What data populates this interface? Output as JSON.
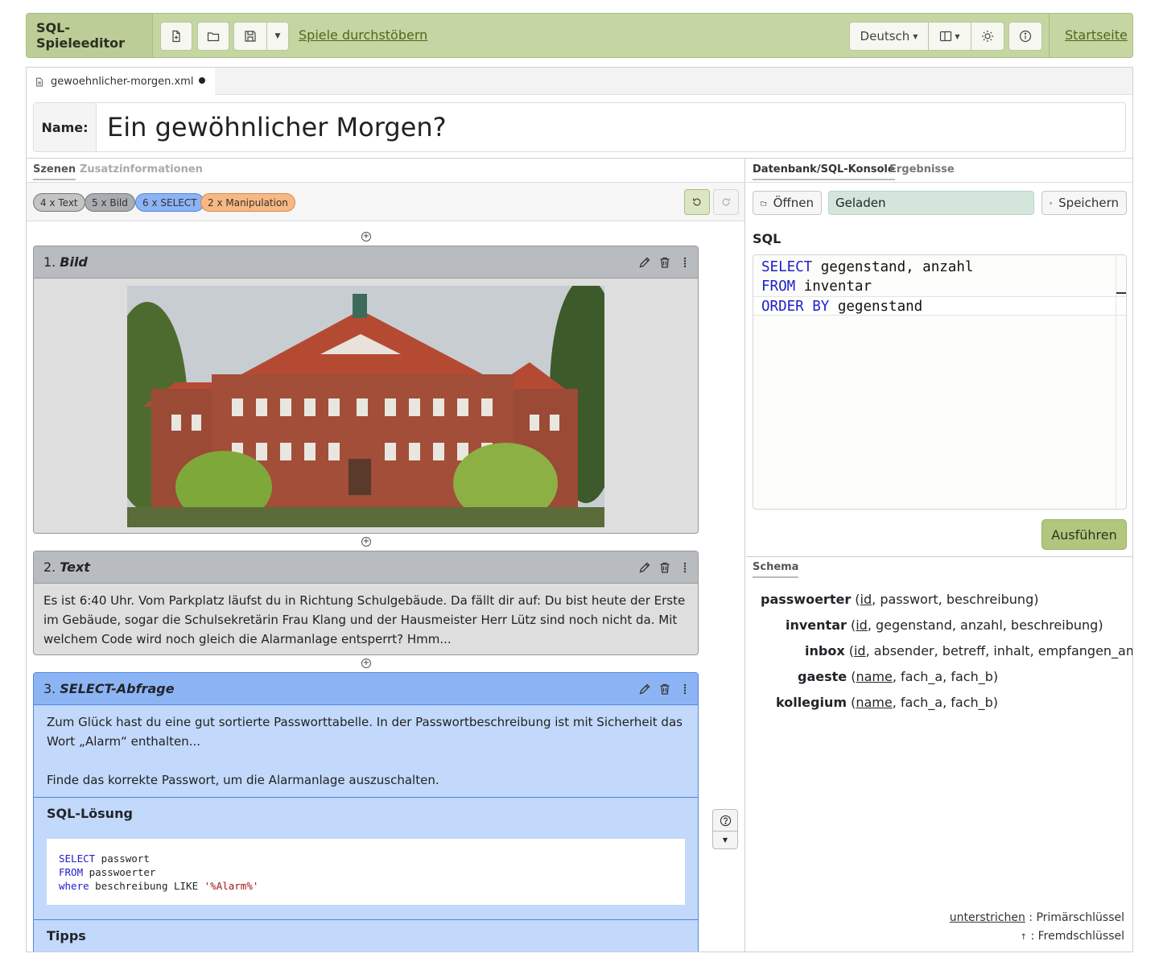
{
  "app": {
    "brand": "SQL-Spieleeditor",
    "browse_link": "Spiele durchstöbern",
    "language": "Deutsch",
    "home_link": "Startseite"
  },
  "file_tab": {
    "filename": "gewoehnlicher-morgen.xml"
  },
  "name_field": {
    "label": "Name:",
    "value": "Ein gewöhnlicher Morgen?"
  },
  "left_tabs": [
    "Szenen",
    "Zusatzinformationen"
  ],
  "badges": [
    {
      "label": "4 x Text",
      "color": "#c4c4c4"
    },
    {
      "label": "5 x Bild",
      "color": "#a9acb0"
    },
    {
      "label": "6 x SELECT",
      "color": "#8cb4f5"
    },
    {
      "label": "2 x Manipulation",
      "color": "#f7b884"
    }
  ],
  "scenes": [
    {
      "number": "1.",
      "title": "Bild"
    },
    {
      "number": "2.",
      "title": "Text",
      "text": "Es ist 6:40 Uhr. Vom Parkplatz läufst du in Richtung Schulgebäude. Da fällt dir auf: Du bist heute der Erste im Gebäude, sogar die Schulsekretärin Frau Klang und der Hausmeister Herr Lütz sind noch nicht da. Mit welchem Code wird noch gleich die Alarmanlage entsperrt? Hmm..."
    },
    {
      "number": "3.",
      "title": "SELECT-Abfrage",
      "text1": "Zum Glück hast du eine gut sortierte Passworttabelle. In der Passwortbeschreibung ist mit Sicherheit das Wort „Alarm“ enthalten...",
      "text2": "Finde das korrekte Passwort, um die Alarmanlage auszuschalten.",
      "solution_title": "SQL-Lösung",
      "tips_title": "Tipps",
      "solution_code": [
        {
          "kw": "SELECT",
          "rest": " passwort"
        },
        {
          "kw": "FROM",
          "rest": " passwoerter"
        },
        {
          "kw": "where",
          "rest": " beschreibung LIKE ",
          "str": "'%Alarm%'"
        }
      ]
    }
  ],
  "right_tabs": [
    "Datenbank/SQL-Konsole",
    "Ergebnisse"
  ],
  "db": {
    "open_label": "Öffnen",
    "status": "Geladen",
    "save_label": "Speichern"
  },
  "sql": {
    "label": "SQL",
    "lines": [
      {
        "kw": "SELECT",
        "rest": " gegenstand, anzahl"
      },
      {
        "kw": "FROM",
        "rest": " inventar"
      },
      {
        "kw": "ORDER BY",
        "rest": " gegenstand"
      }
    ],
    "run_label": "Ausführen"
  },
  "schema": {
    "tab": "Schema",
    "tables": [
      {
        "name": "passwoerter",
        "pk": "id",
        "cols": ", passwort, beschreibung)"
      },
      {
        "name": "inventar",
        "pk": "id",
        "cols": ", gegenstand, anzahl, beschreibung)"
      },
      {
        "name": "inbox",
        "pk": "id",
        "cols": ", absender, betreff, inhalt, empfangen_am)"
      },
      {
        "name": "gaeste",
        "pk": "name",
        "cols": ", fach_a, fach_b)"
      },
      {
        "name": "kollegium",
        "pk": "name",
        "cols": ", fach_a, fach_b)"
      }
    ],
    "legend_pk_term": "unterstrichen",
    "legend_pk": ": Primärschlüssel",
    "legend_fk_term": "↑",
    "legend_fk": ": Fremdschlüssel"
  }
}
